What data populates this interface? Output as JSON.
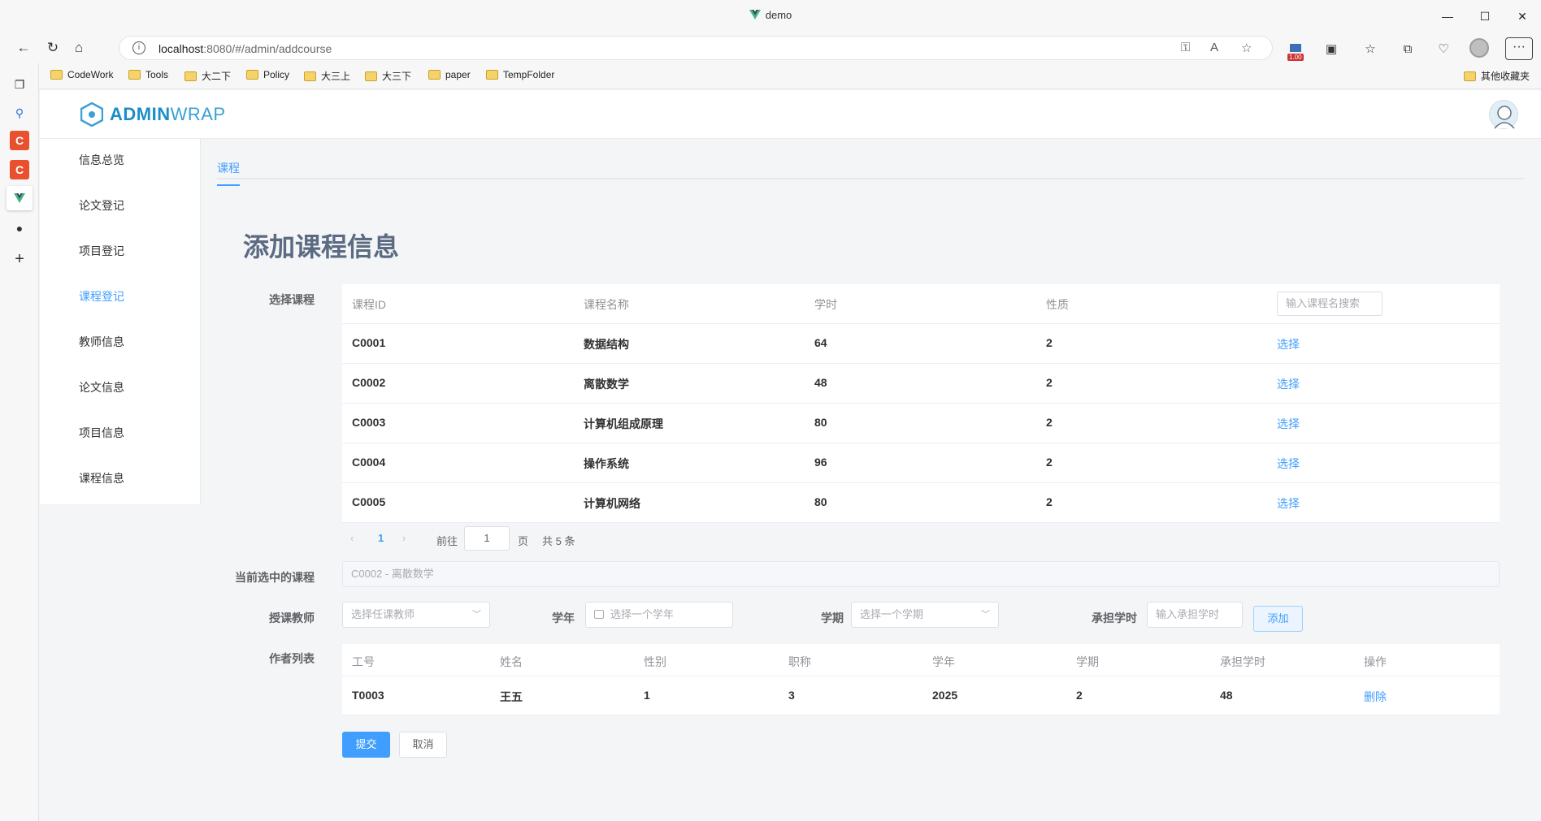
{
  "browser": {
    "window_title": "demo",
    "url_host": "localhost",
    "url_rest": ":8080/#/admin/addcourse",
    "extension_badge": "1.00",
    "bookmarks": [
      "CodeWork",
      "Tools",
      "大二下",
      "Policy",
      "大三上",
      "大三下",
      "paper",
      "TempFolder"
    ],
    "other_bookmarks": "其他收藏夹"
  },
  "app": {
    "brand_bold": "ADMIN",
    "brand_light": "WRAP",
    "menu": [
      {
        "label": "信息总览",
        "active": false
      },
      {
        "label": "论文登记",
        "active": false
      },
      {
        "label": "项目登记",
        "active": false
      },
      {
        "label": "课程登记",
        "active": true
      },
      {
        "label": "教师信息",
        "active": false
      },
      {
        "label": "论文信息",
        "active": false
      },
      {
        "label": "项目信息",
        "active": false
      },
      {
        "label": "课程信息",
        "active": false
      }
    ],
    "tab": "课程",
    "page_title": "添加课程信息"
  },
  "course_select": {
    "label": "选择课程",
    "headers": [
      "课程ID",
      "课程名称",
      "学时",
      "性质"
    ],
    "search_placeholder": "输入课程名搜索",
    "rows": [
      {
        "id": "C0001",
        "name": "数据结构",
        "hours": "64",
        "type": "2",
        "action": "选择"
      },
      {
        "id": "C0002",
        "name": "离散数学",
        "hours": "48",
        "type": "2",
        "action": "选择"
      },
      {
        "id": "C0003",
        "name": "计算机组成原理",
        "hours": "80",
        "type": "2",
        "action": "选择"
      },
      {
        "id": "C0004",
        "name": "操作系统",
        "hours": "96",
        "type": "2",
        "action": "选择"
      },
      {
        "id": "C0005",
        "name": "计算机网络",
        "hours": "80",
        "type": "2",
        "action": "选择"
      }
    ],
    "pager": {
      "prev": "‹",
      "current": "1",
      "next": "›",
      "goto_label": "前往",
      "goto_value": "1",
      "page_unit": "页",
      "total": "共 5 条"
    }
  },
  "current_course": {
    "label": "当前选中的课程",
    "value": "C0002 - 离散数学"
  },
  "assign": {
    "teacher_label": "授课教师",
    "teacher_placeholder": "选择任课教师",
    "year_label": "学年",
    "year_placeholder": "选择一个学年",
    "term_label": "学期",
    "term_placeholder": "选择一个学期",
    "hours_label": "承担学时",
    "hours_placeholder": "输入承担学时",
    "add_button": "添加"
  },
  "author_list": {
    "label": "作者列表",
    "headers": [
      "工号",
      "姓名",
      "性别",
      "职称",
      "学年",
      "学期",
      "承担学时",
      "操作"
    ],
    "rows": [
      {
        "cells": [
          "T0003",
          "王五",
          "1",
          "3",
          "2025",
          "2",
          "48"
        ],
        "action": "删除"
      }
    ]
  },
  "form_buttons": {
    "submit": "提交",
    "cancel": "取消"
  }
}
